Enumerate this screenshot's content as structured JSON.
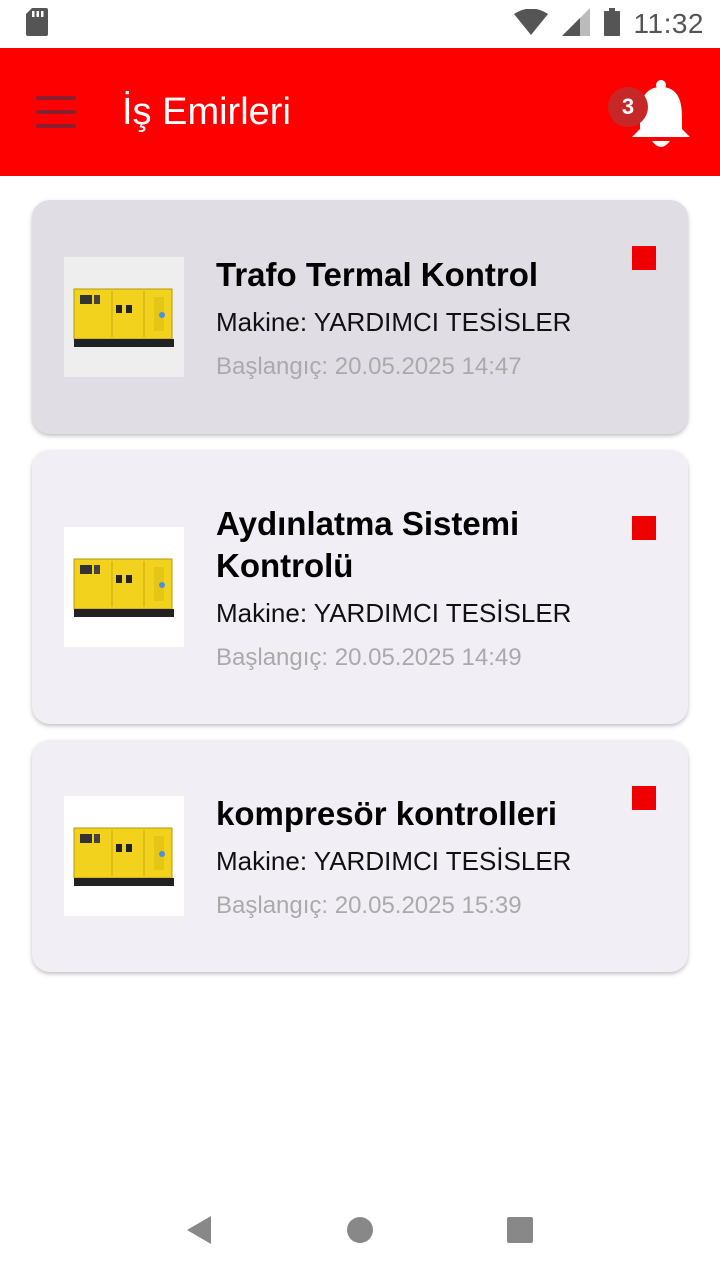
{
  "status_bar": {
    "time": "11:32"
  },
  "app_bar": {
    "title": "İş Emirleri",
    "notification_count": "3"
  },
  "work_orders": [
    {
      "title": "Trafo Termal Kontrol",
      "machine": "Makine: YARDIMCI TESİSLER",
      "start": "Başlangıç: 20.05.2025 14:47",
      "status_color": "#ee0000"
    },
    {
      "title": "Aydınlatma Sistemi Kontrolü",
      "machine": "Makine: YARDIMCI TESİSLER",
      "start": "Başlangıç: 20.05.2025 14:49",
      "status_color": "#ee0000"
    },
    {
      "title": "kompresör kontrolleri",
      "machine": "Makine: YARDIMCI TESİSLER",
      "start": "Başlangıç: 20.05.2025 15:39",
      "status_color": "#ee0000"
    }
  ],
  "icons": {
    "sd_card": "sd-card-icon",
    "wifi": "wifi-icon",
    "signal": "signal-icon",
    "battery": "battery-icon",
    "menu": "menu-icon",
    "bell": "bell-icon",
    "generator": "generator-icon",
    "back": "back-icon",
    "home": "home-icon",
    "recents": "recents-icon"
  },
  "colors": {
    "app_bar": "#ff0000",
    "badge": "#c62828",
    "status": "#ee0000"
  }
}
